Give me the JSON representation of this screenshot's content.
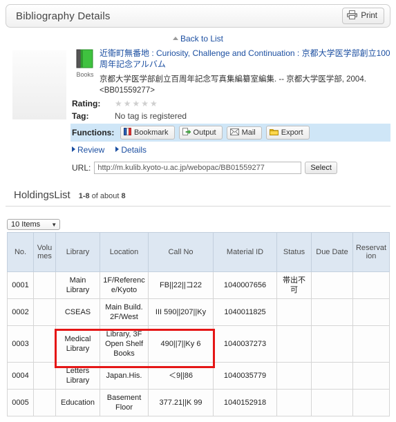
{
  "header": {
    "title": "Bibliography Details",
    "print_label": "Print",
    "print_icon": "printer-icon"
  },
  "nav": {
    "back_label": "Back to List"
  },
  "bibliography": {
    "material_type": "Books",
    "title": "近衞町無番地 : Curiosity, Challenge and Continuation : 京都大学医学部創立100周年記念アルバム",
    "statement": "京都大学医学部創立百周年記念写真集編纂室編集. -- 京都大学医学部, 2004. <BB01559277>",
    "rating_label": "Rating:",
    "rating_stars": "★★★★★",
    "rating_value": 0,
    "tag_label": "Tag:",
    "tag_value": "No tag is registered",
    "functions_label": "Functions:",
    "functions": [
      {
        "label": "Bookmark",
        "icon": "bookmark-icon"
      },
      {
        "label": "Output",
        "icon": "output-icon"
      },
      {
        "label": "Mail",
        "icon": "mail-icon"
      },
      {
        "label": "Export",
        "icon": "export-icon"
      }
    ],
    "review_label": "Review",
    "details_label": "Details",
    "url_label": "URL:",
    "url_value": "http://m.kulib.kyoto-u.ac.jp/webopac/BB01559277",
    "select_label": "Select"
  },
  "holdings": {
    "title": "HoldingsList",
    "range": "1-8",
    "of_text": "of about",
    "total": "8",
    "items_per_page": "10 Items",
    "columns": [
      "No.",
      "Volumes",
      "Library",
      "Location",
      "Call No",
      "Material ID",
      "Status",
      "Due Date",
      "Reservation"
    ],
    "rows": [
      {
        "no": "0001",
        "volumes": "",
        "library": "Main Library",
        "location": "1F/Reference/Kyoto",
        "call_no": "FB||22||コ22",
        "material_id": "1040007656",
        "status": "帯出不可",
        "due_date": "",
        "reservation": "",
        "highlighted": false
      },
      {
        "no": "0002",
        "volumes": "",
        "library": "CSEAS",
        "location": "Main Build. 2F/West",
        "call_no": "III 590||207||Ky",
        "material_id": "1040011825",
        "status": "",
        "due_date": "",
        "reservation": "",
        "highlighted": false
      },
      {
        "no": "0003",
        "volumes": "",
        "library": "Medical Library",
        "location": "Library, 3F Open Shelf Books",
        "call_no": "490||7||Ky 6",
        "material_id": "1040037273",
        "status": "",
        "due_date": "",
        "reservation": "",
        "highlighted": true
      },
      {
        "no": "0004",
        "volumes": "",
        "library": "Letters Library",
        "location": "Japan.His.",
        "call_no": "＜9||86",
        "material_id": "1040035779",
        "status": "",
        "due_date": "",
        "reservation": "",
        "highlighted": false
      },
      {
        "no": "0005",
        "volumes": "",
        "library": "Education",
        "location": "Basement Floor",
        "call_no": "377.21||K 99",
        "material_id": "1040152918",
        "status": "",
        "due_date": "",
        "reservation": "",
        "highlighted": false
      }
    ]
  },
  "colors": {
    "link": "#2a5db0",
    "functions_bar": "#cfe6f7",
    "table_header": "#dde7f2",
    "highlight": "#e51616"
  }
}
